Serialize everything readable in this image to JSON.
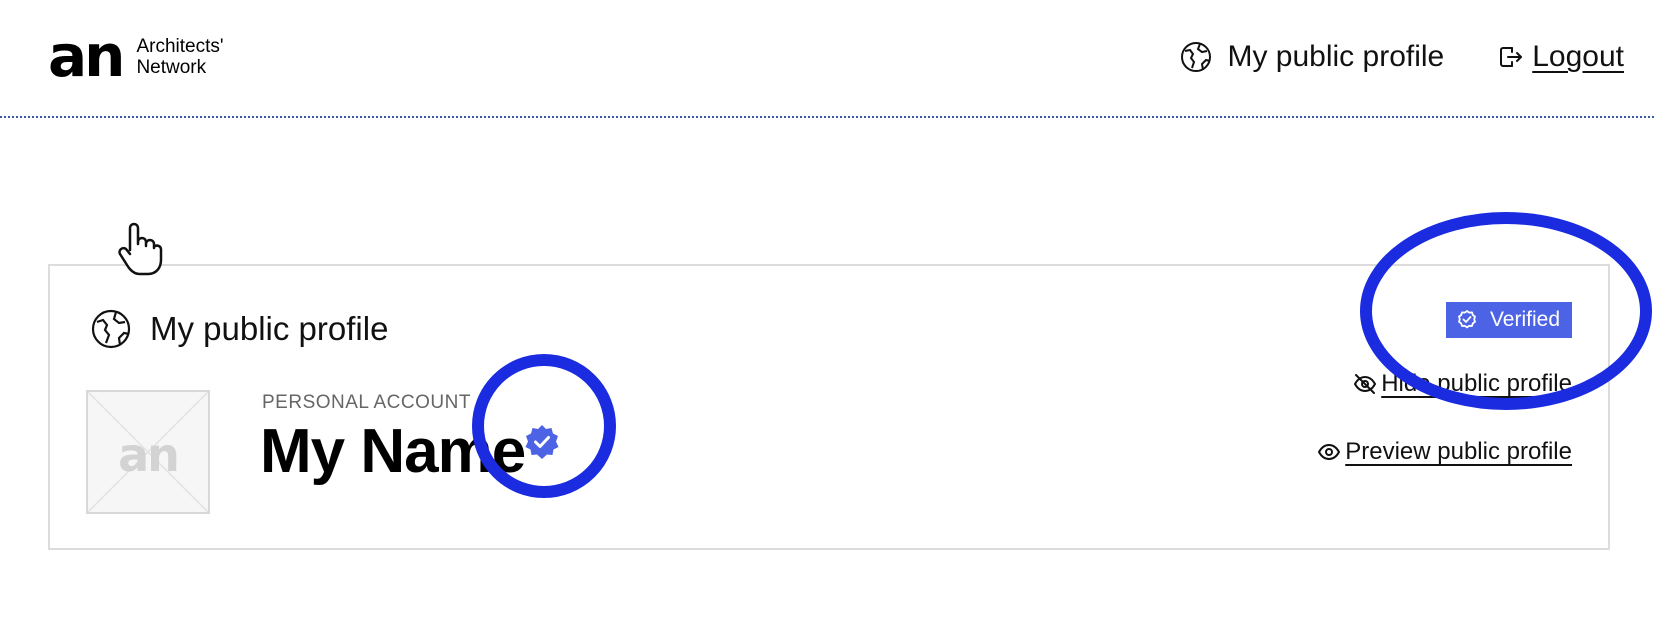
{
  "brand": {
    "mark": "an",
    "name_line1": "Architects'",
    "name_line2": "Network"
  },
  "nav": {
    "public_profile_label": "My public profile",
    "logout_label": "Logout"
  },
  "profile_card": {
    "title": "My public profile",
    "account_type": "PERSONAL ACCOUNT",
    "name": "My Name",
    "avatar_placeholder": "an",
    "verified_label": "Verified",
    "hide_link": "Hide public profile",
    "preview_link": "Preview public profile"
  },
  "icons": {
    "globe": "globe-icon",
    "logout": "logout-icon",
    "verified": "check-circle-icon",
    "seal": "verified-seal-icon",
    "eye_off": "eye-off-icon",
    "eye": "eye-icon",
    "cursor": "hand-pointer-icon"
  },
  "colors": {
    "accent": "#4c63e6",
    "annotation": "#1a2be0",
    "border": "#dcdcdc",
    "header_rule": "#3a5aa8"
  }
}
